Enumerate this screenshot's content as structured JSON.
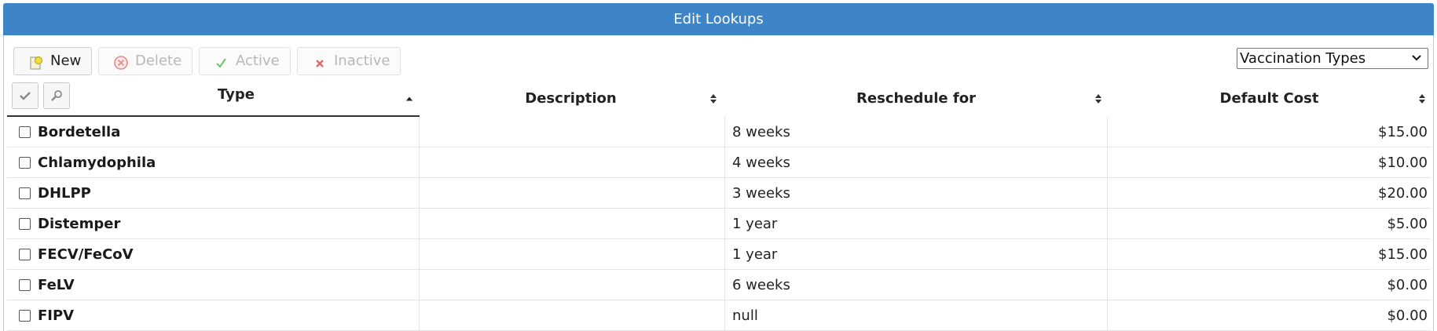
{
  "window": {
    "title": "Edit Lookups"
  },
  "toolbar": {
    "new_label": "New",
    "delete_label": "Delete",
    "active_label": "Active",
    "inactive_label": "Inactive"
  },
  "lookup_select": {
    "selected": "Vaccination Types"
  },
  "table": {
    "columns": {
      "type": "Type",
      "description": "Description",
      "reschedule": "Reschedule for",
      "cost": "Default Cost"
    },
    "rows": [
      {
        "type": "Bordetella",
        "description": "",
        "reschedule": "8 weeks",
        "cost": "$15.00"
      },
      {
        "type": "Chlamydophila",
        "description": "",
        "reschedule": "4 weeks",
        "cost": "$10.00"
      },
      {
        "type": "DHLPP",
        "description": "",
        "reschedule": "3 weeks",
        "cost": "$20.00"
      },
      {
        "type": "Distemper",
        "description": "",
        "reschedule": "1 year",
        "cost": "$5.00"
      },
      {
        "type": "FECV/FeCoV",
        "description": "",
        "reschedule": "1 year",
        "cost": "$15.00"
      },
      {
        "type": "FeLV",
        "description": "",
        "reschedule": "6 weeks",
        "cost": "$0.00"
      },
      {
        "type": "FIPV",
        "description": "",
        "reschedule": "null",
        "cost": "$0.00"
      }
    ]
  },
  "colors": {
    "titlebar": "#3d85c6",
    "disabled_text": "#b8b8b8",
    "active_check": "#6cc36c",
    "inactive_cross": "#e06a6a"
  },
  "icons": {
    "new": "new-document-icon",
    "delete": "delete-circle-icon",
    "active": "check-icon",
    "inactive": "cross-icon",
    "select_all": "checkmark-icon",
    "filter": "magnifier-icon",
    "sort": "sort-arrows-icon"
  }
}
